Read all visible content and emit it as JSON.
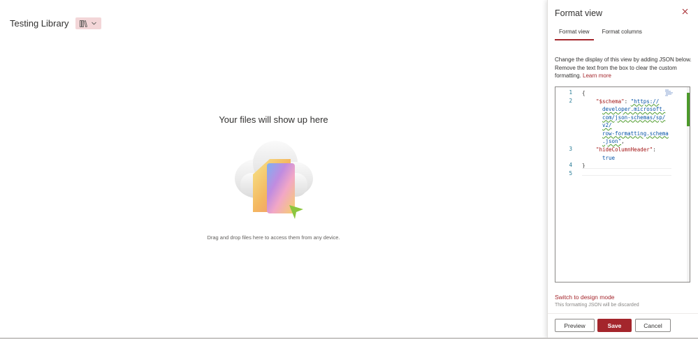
{
  "library": {
    "title": "Testing Library",
    "view_icon": "library-icon",
    "view_chevron": "chevron-down-icon"
  },
  "empty_state": {
    "title": "Your files will show up here",
    "subtitle": "Drag and drop files here to access them from any device."
  },
  "panel": {
    "title": "Format view",
    "close_icon": "close-icon",
    "tabs": [
      {
        "label": "Format view",
        "active": true
      },
      {
        "label": "Format columns",
        "active": false
      }
    ],
    "description": "Change the display of this view by adding JSON below. Remove the text from the box to clear the custom formatting.",
    "learn_more": "Learn more",
    "editor": {
      "line_numbers": [
        "1",
        "2",
        "3",
        "4",
        "5"
      ],
      "lines": [
        {
          "text": "{"
        },
        {
          "key": "\"$schema\"",
          "sep": ": ",
          "value_lines": [
            "\"https://",
            "developer.microsoft.",
            "com/json-schemas/sp/",
            "v2/",
            "row-formatting.schema",
            ".json\""
          ],
          "trail": ","
        },
        {
          "key": "\"hideColumnHeader\"",
          "sep": ":",
          "value": "true"
        },
        {
          "text": "}"
        },
        {
          "text": ""
        }
      ]
    },
    "switch_mode": "Switch to design mode",
    "discard_note": "This formatting JSON will be discarded",
    "buttons": {
      "preview": "Preview",
      "save": "Save",
      "cancel": "Cancel"
    }
  },
  "colors": {
    "accent": "#a4262c",
    "view_switch_bg": "#f3d6d8",
    "json_key": "#a31515",
    "json_string": "#0451a5",
    "squiggle": "#4c9a2a",
    "line_number": "#237893"
  }
}
